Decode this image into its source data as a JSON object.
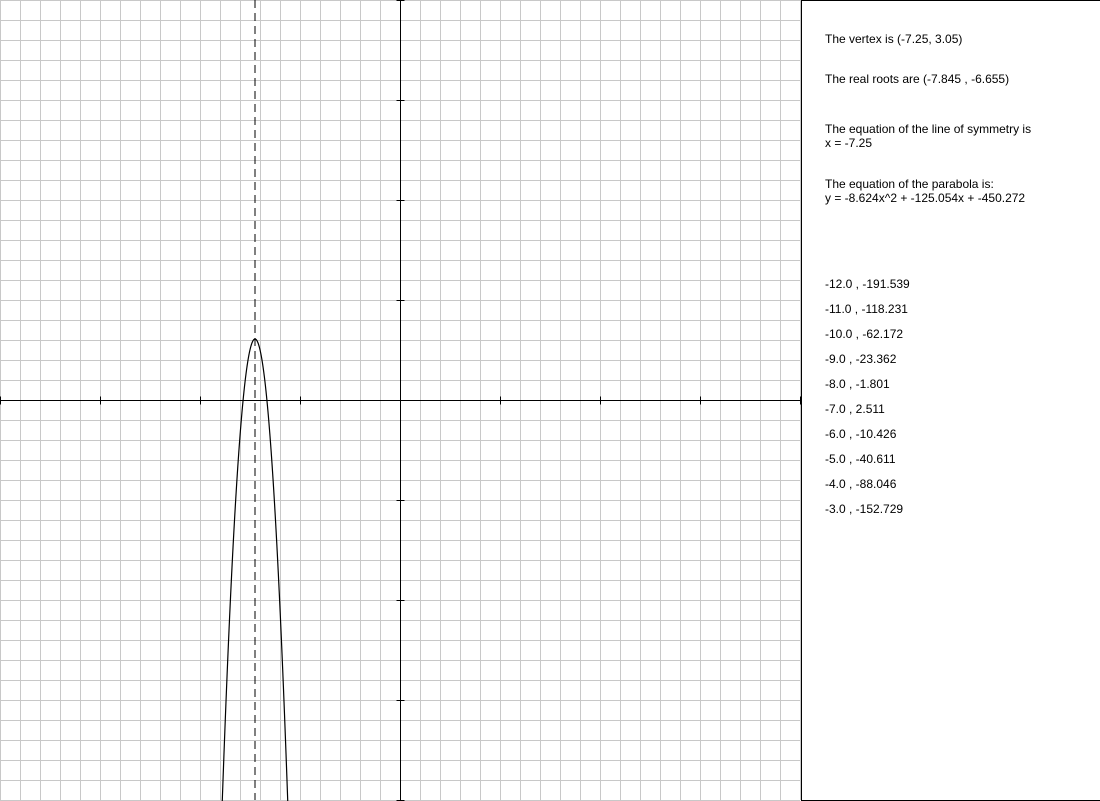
{
  "colors": {
    "grid": "#c8c8c8",
    "axis": "#000000",
    "curve": "#000000",
    "background": "#ffffff"
  },
  "info": {
    "vertex_text": "The vertex is (-7.25, 3.05)",
    "roots_text": "The real roots are (-7.845 , -6.655)",
    "symmetry_label": "The equation of the line of symmetry is",
    "symmetry_equation": "x = -7.25",
    "parabola_label": "The equation of the parabola is:",
    "parabola_equation": "y = -8.624x^2 + -125.054x + -450.272"
  },
  "points": [
    "-12.0 , -191.539",
    "-11.0 , -118.231",
    "-10.0 , -62.172",
    "-9.0 , -23.362",
    "-8.0 , -1.801",
    "-7.0 , 2.511",
    "-6.0 , -10.426",
    "-5.0 , -40.611",
    "-4.0 , -88.046",
    "-3.0 , -152.729"
  ],
  "chart_data": {
    "type": "line",
    "xlim": [
      -20,
      20
    ],
    "ylim": [
      -20,
      20
    ],
    "grid": true,
    "parabola": {
      "a": -8.624,
      "b": -125.054,
      "c": -450.272
    },
    "symmetry_x": -7.25,
    "vertex": [
      -7.25,
      3.05
    ]
  }
}
